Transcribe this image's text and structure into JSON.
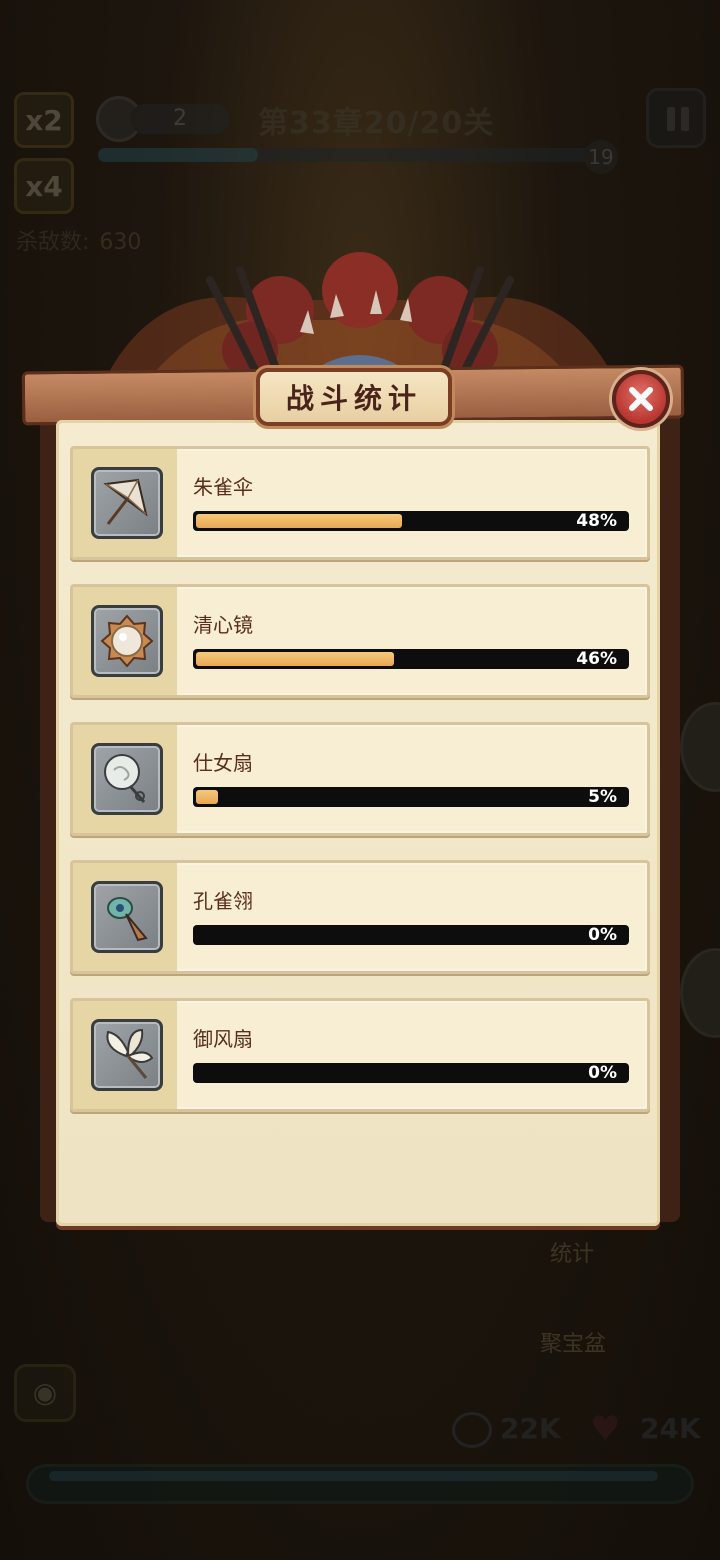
{
  "hud": {
    "speed_x2": "x2",
    "speed_x4": "x4",
    "wave_count": "2",
    "chapter": "第33章20/20关",
    "progress_number": "19",
    "stage_progress": 0.32,
    "kills_label": "杀敌数:",
    "kills_value": "630",
    "stats_label": "统计",
    "treasure_label": "聚宝盆",
    "resource_1": "22K",
    "resource_2": "24K"
  },
  "panel": {
    "title": "战斗统计",
    "close_icon": "close-icon",
    "colors": {
      "bar_fill": "#eeb464",
      "bar_track": "#0d0d0d",
      "close": "#c0443c"
    },
    "items": [
      {
        "name": "朱雀伞",
        "percent": 48,
        "label": "48%",
        "icon": "umbrella-icon"
      },
      {
        "name": "清心镜",
        "percent": 46,
        "label": "46%",
        "icon": "mirror-icon"
      },
      {
        "name": "仕女扇",
        "percent": 5,
        "label": "5%",
        "icon": "round-fan-icon"
      },
      {
        "name": "孔雀翎",
        "percent": 0,
        "label": "0%",
        "icon": "peacock-feather-icon"
      },
      {
        "name": "御风扇",
        "percent": 0,
        "label": "0%",
        "icon": "feather-fan-icon"
      }
    ]
  }
}
